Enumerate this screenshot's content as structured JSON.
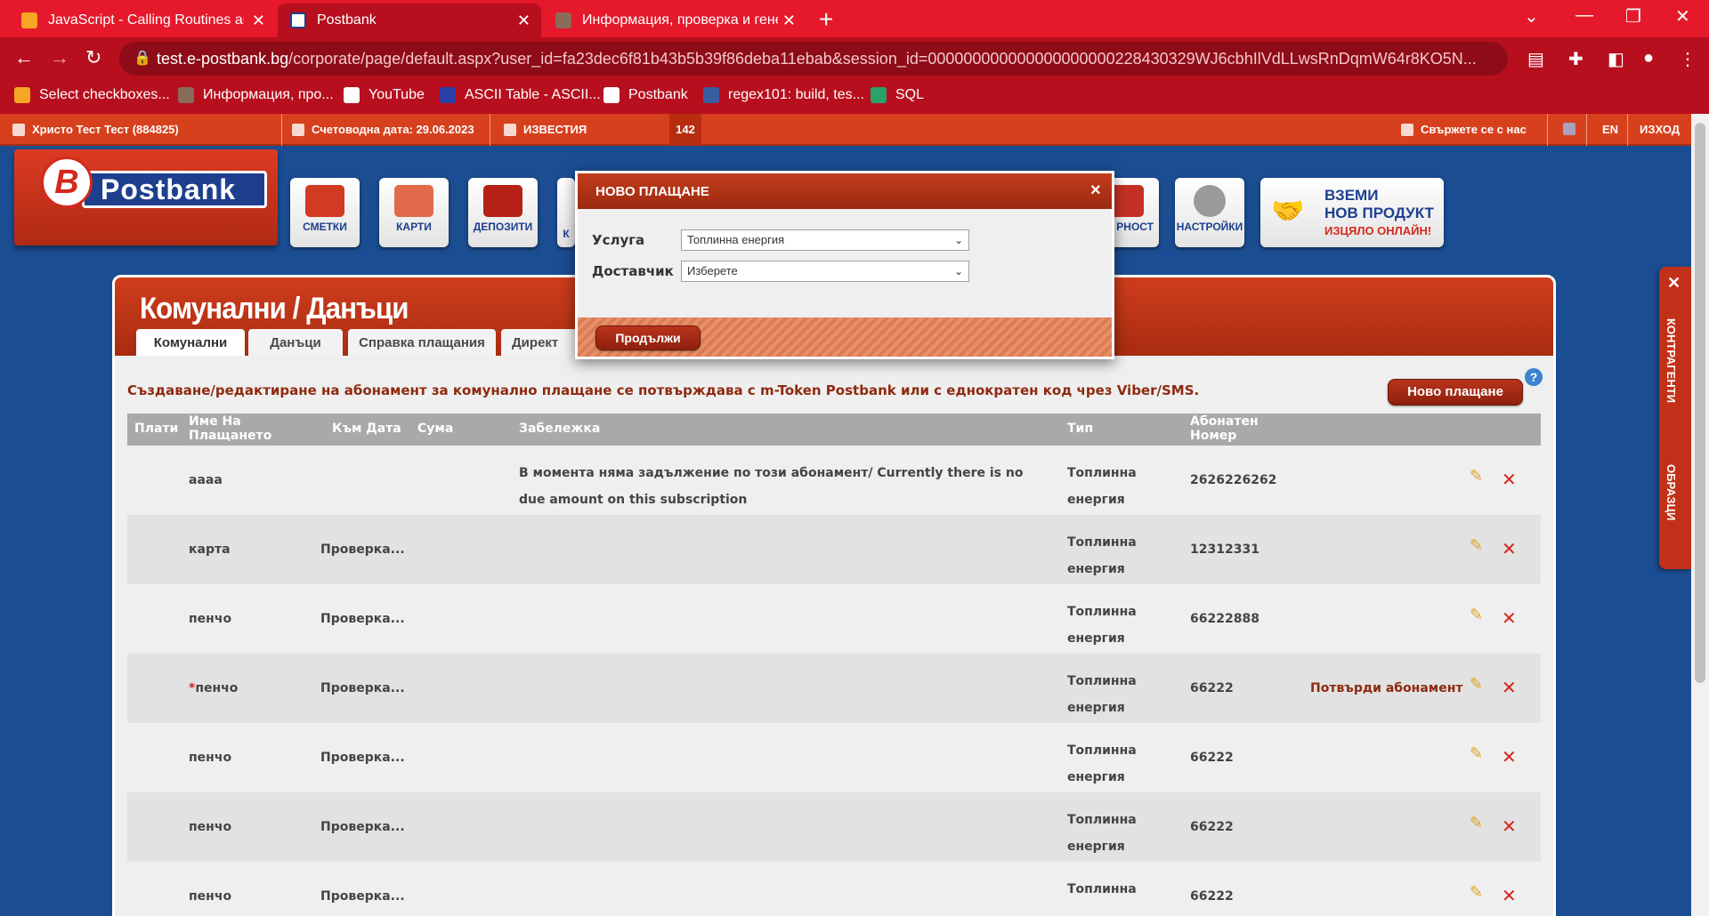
{
  "browser": {
    "tabs": [
      {
        "label": "JavaScript - Calling Routines and"
      },
      {
        "label": "Postbank"
      },
      {
        "label": "Информация, проверка и генер"
      }
    ],
    "url_host": "test.e-postbank.bg",
    "url_path": "/corporate/page/default.aspx?user_id=fa23dec6f81b43b5b39f86deba11ebab&session_id=000000000000000000000228430329WJ6cbhIlVdLLwsRnDqmW64r8KO5N...",
    "bookmarks": [
      {
        "label": "Select checkboxes..."
      },
      {
        "label": "Информация, про..."
      },
      {
        "label": "YouTube"
      },
      {
        "label": "ASCII Table - ASCII..."
      },
      {
        "label": "Postbank"
      },
      {
        "label": "regex101: build, tes..."
      },
      {
        "label": "SQL"
      }
    ]
  },
  "topstrip": {
    "user": "Христо Тест Тест (884825)",
    "accounting_date": "Счетоводна дата: 29.06.2023",
    "news": "ИЗВЕСТИЯ",
    "news_count": "142",
    "contact": "Свържете се с нас",
    "lang": "EN",
    "logout": "ИЗХОД"
  },
  "logo": {
    "letter": "B",
    "text": "Postbank"
  },
  "nav": {
    "accounts": "СМЕТКИ",
    "cards": "КАРТИ",
    "deposits": "ДЕПОЗИТИ",
    "k": "К",
    "security": "РНОСТ",
    "settings": "НАСТРОЙКИ",
    "promo_line1": "ВЗЕМИ",
    "promo_line2": "НОВ ПРОДУКТ",
    "promo_line3": "ИЗЦЯЛО ОНЛАЙН!"
  },
  "panel": {
    "title": "Комунални / Данъци",
    "tabs": [
      "Комунални",
      "Данъци",
      "Справка плащания",
      "Директ"
    ],
    "notice": "Създаване/редактиране на абонамент за комунално плащане се потвърждава с m-Token Postbank или с еднократен код чрез Viber/SMS.",
    "new_payment": "Ново плащане",
    "help": "?"
  },
  "table": {
    "headers": {
      "pay": "Плати",
      "name_l1": "Име На",
      "name_l2": "Плащането",
      "date": "Към Дата",
      "sum": "Сума",
      "note": "Забележка",
      "type": "Тип",
      "num_l1": "Абонатен",
      "num_l2": "Номер"
    },
    "rows": [
      {
        "name": "aaaa",
        "date": "",
        "note": "В момента няма задължение по този абонамент/ Currently there is no due amount on this subscription",
        "type": "Топлинна енергия",
        "num": "2626226262",
        "confirm": ""
      },
      {
        "name": "карта",
        "date": "Проверка...",
        "note": "",
        "type": "Топлинна енергия",
        "num": "12312331",
        "confirm": ""
      },
      {
        "name": "пенчо",
        "date": "Проверка...",
        "note": "",
        "type": "Топлинна енергия",
        "num": "66222888",
        "confirm": ""
      },
      {
        "name": "пенчо",
        "star": "*",
        "date": "Проверка...",
        "note": "",
        "type": "Топлинна енергия",
        "num": "66222",
        "confirm": "Потвърди абонамент"
      },
      {
        "name": "пенчо",
        "date": "Проверка...",
        "note": "",
        "type": "Топлинна енергия",
        "num": "66222",
        "confirm": ""
      },
      {
        "name": "пенчо",
        "date": "Проверка...",
        "note": "",
        "type": "Топлинна енергия",
        "num": "66222",
        "confirm": ""
      },
      {
        "name": "пенчо",
        "date": "Проверка...",
        "note": "",
        "type": "Топлинна",
        "num": "66222",
        "confirm": ""
      }
    ]
  },
  "side": {
    "contractors": "КОНТРАГЕНТИ",
    "templates": "ОБРАЗЦИ"
  },
  "modal": {
    "title": "НОВО ПЛАЩАНЕ",
    "close": "×",
    "service_label": "Услуга",
    "service_value": "Топлинна енергия",
    "provider_label": "Доставчик",
    "provider_value": "Изберете",
    "continue": "Продължи"
  }
}
